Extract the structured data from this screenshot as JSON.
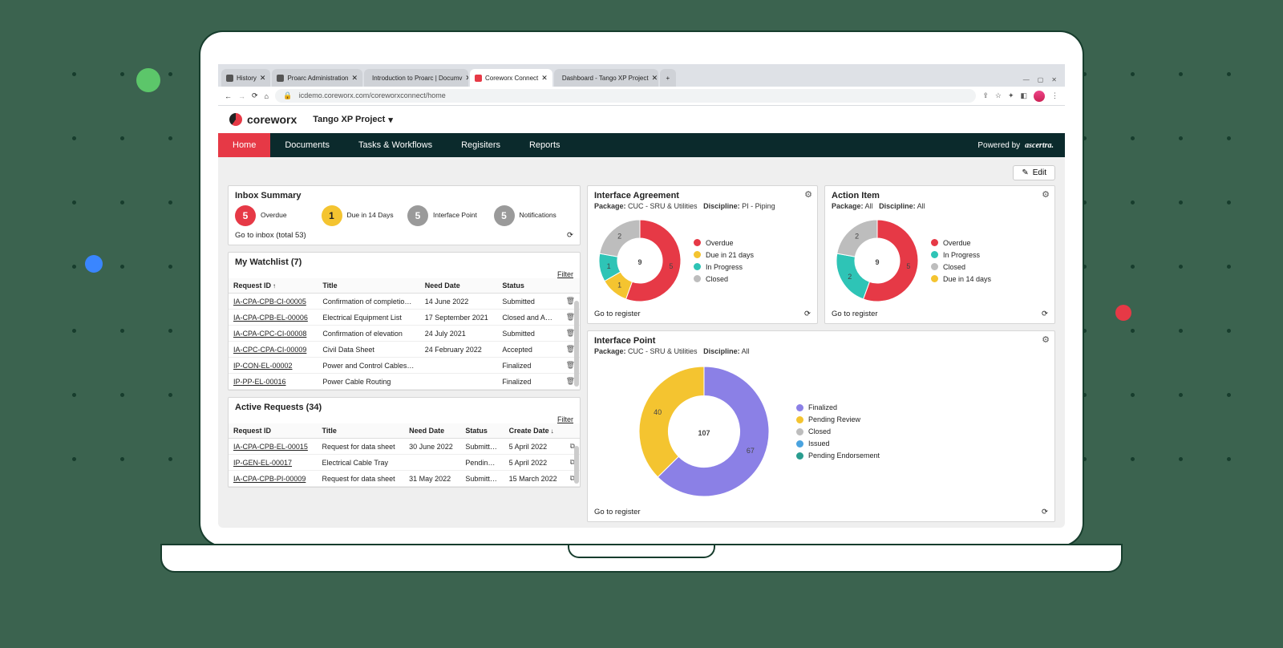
{
  "browser": {
    "tabs": [
      {
        "label": "History",
        "icon": "p",
        "active": false
      },
      {
        "label": "Proarc Administration",
        "icon": "p",
        "active": false
      },
      {
        "label": "Introduction to Proarc | Documv",
        "icon": "p",
        "active": false
      },
      {
        "label": "Coreworx Connect",
        "icon": "cw",
        "active": true
      },
      {
        "label": "Dashboard - Tango XP Project",
        "icon": "cw",
        "active": false
      }
    ],
    "url": "icdemo.coreworx.com/coreworxconnect/home"
  },
  "header": {
    "brand": "coreworx",
    "project": "Tango XP Project"
  },
  "nav": {
    "items": [
      "Home",
      "Documents",
      "Tasks & Workflows",
      "Regisiters",
      "Reports"
    ],
    "active_index": 0,
    "powered_by": "Powered by",
    "powered_brand": "ascertra."
  },
  "toolbar": {
    "edit": "Edit"
  },
  "inbox": {
    "title": "Inbox Summary",
    "stats": [
      {
        "n": "5",
        "label": "Overdue",
        "bg": "#e63946"
      },
      {
        "n": "1",
        "label": "Due in 14 Days",
        "bg": "#f4c430"
      },
      {
        "n": "5",
        "label": "Interface Point",
        "bg": "#9a9a9a"
      },
      {
        "n": "5",
        "label": "Notifications",
        "bg": "#9a9a9a"
      }
    ],
    "goto": "Go to inbox (total 53)"
  },
  "watchlist": {
    "title": "My Watchlist (7)",
    "filter": "Filter",
    "cols": [
      "Request ID",
      "Title",
      "Need Date",
      "Status"
    ],
    "sort_col": 0,
    "sort_dir": "↑",
    "rows": [
      {
        "id": "IA-CPA-CPB-CI-00005",
        "title": "Confirmation of completion of sit…",
        "date": "14 June 2022",
        "status": "Submitted"
      },
      {
        "id": "IA-CPA-CPB-EL-00006",
        "title": "Electrical Equipment List",
        "date": "17 September 2021",
        "status": "Closed and A…"
      },
      {
        "id": "IA-CPA-CPC-CI-00008",
        "title": "Confirmation of elevation",
        "date": "24 July 2021",
        "status": "Submitted"
      },
      {
        "id": "IA-CPC-CPA-CI-00009",
        "title": "Civil Data Sheet",
        "date": "24 February 2022",
        "status": "Accepted"
      },
      {
        "id": "IP-CON-EL-00002",
        "title": "Power and Control Cables (DDSK-…",
        "date": "",
        "status": "Finalized"
      },
      {
        "id": "IP-PP-EL-00016",
        "title": "Power Cable Routing",
        "date": "",
        "status": "Finalized"
      }
    ]
  },
  "active_req": {
    "title": "Active Requests (34)",
    "filter": "Filter",
    "cols": [
      "Request ID",
      "Title",
      "Need Date",
      "Status",
      "Create Date"
    ],
    "sort_col": 4,
    "sort_dir": "↓",
    "rows": [
      {
        "id": "IA-CPA-CPB-EL-00015",
        "title": "Request for data sheet",
        "need": "30 June 2022",
        "status": "Submitt…",
        "create": "5 April 2022"
      },
      {
        "id": "IP-GEN-EL-00017",
        "title": "Electrical Cable Tray",
        "need": "",
        "status": "Pendin…",
        "create": "5 April 2022"
      },
      {
        "id": "IA-CPA-CPB-PI-00009",
        "title": "Request for data sheet",
        "need": "31 May 2022",
        "status": "Submitt…",
        "create": "15 March 2022"
      }
    ]
  },
  "ia": {
    "title": "Interface Agreement",
    "package_lbl": "Package:",
    "package": "CUC - SRU & Utilities",
    "discipline_lbl": "Discipline:",
    "discipline": "PI - Piping",
    "goto": "Go to register"
  },
  "ai": {
    "title": "Action Item",
    "package_lbl": "Package:",
    "package": "All",
    "discipline_lbl": "Discipline:",
    "discipline": "All",
    "goto": "Go to register"
  },
  "ip": {
    "title": "Interface Point",
    "package_lbl": "Package:",
    "package": "CUC - SRU & Utilities",
    "discipline_lbl": "Discipline:",
    "discipline": "All",
    "goto": "Go to register"
  },
  "chart_data": [
    {
      "id": "interface_agreement",
      "type": "pie",
      "title": "Interface Agreement",
      "total": 9,
      "series": [
        {
          "name": "Overdue",
          "value": 5,
          "color": "#e63946"
        },
        {
          "name": "Due in 21 days",
          "value": 1,
          "color": "#f4c430"
        },
        {
          "name": "In Progress",
          "value": 1,
          "color": "#2ec4b6"
        },
        {
          "name": "Closed",
          "value": 2,
          "color": "#bdbdbd"
        }
      ]
    },
    {
      "id": "action_item",
      "type": "pie",
      "title": "Action Item",
      "total": 9,
      "series": [
        {
          "name": "Overdue",
          "value": 5,
          "color": "#e63946"
        },
        {
          "name": "In Progress",
          "value": 2,
          "color": "#2ec4b6"
        },
        {
          "name": "Closed",
          "value": 2,
          "color": "#bdbdbd"
        },
        {
          "name": "Due in 14 days",
          "value": 0,
          "color": "#f4c430"
        }
      ]
    },
    {
      "id": "interface_point",
      "type": "pie",
      "title": "Interface Point",
      "total": 107,
      "series": [
        {
          "name": "Finalized",
          "value": 67,
          "color": "#8b80e6"
        },
        {
          "name": "Pending Review",
          "value": 40,
          "color": "#f4c430"
        },
        {
          "name": "Closed",
          "value": 0,
          "color": "#bdbdbd"
        },
        {
          "name": "Issued",
          "value": 0,
          "color": "#4aa3df"
        },
        {
          "name": "Pending Endorsement",
          "value": 0,
          "color": "#2a9d8f"
        }
      ]
    }
  ]
}
